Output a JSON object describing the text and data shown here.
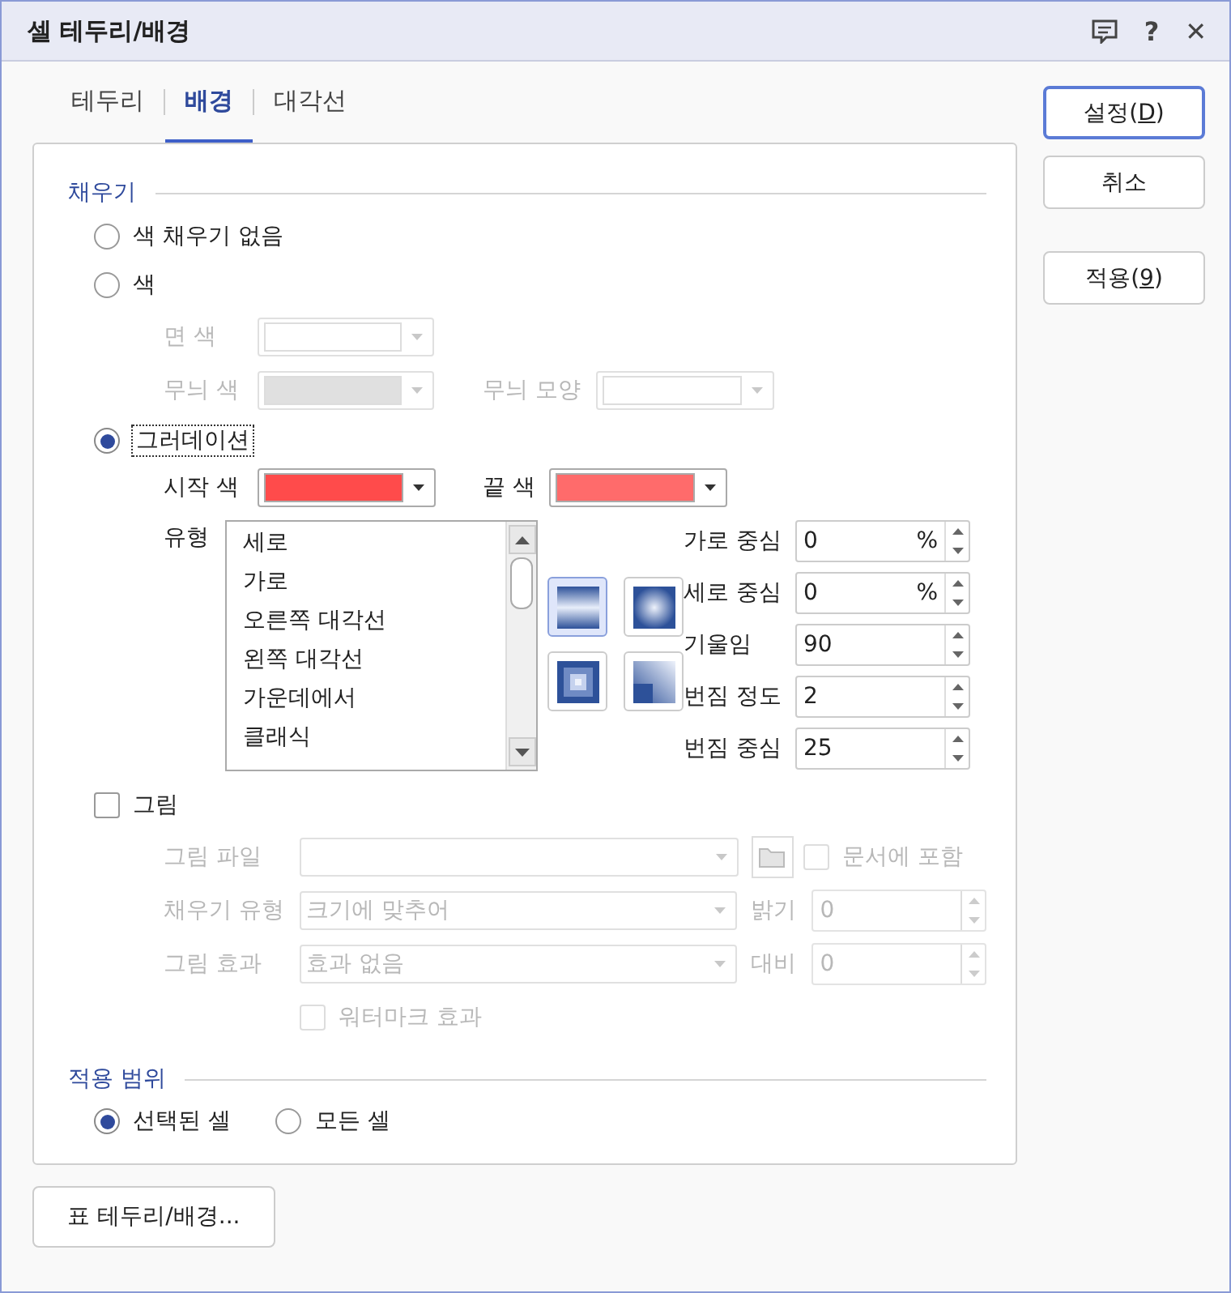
{
  "window": {
    "title": "셀 테두리/배경",
    "help_button": "?",
    "close_button": "✕"
  },
  "tabs": [
    {
      "label": "테두리",
      "selected": false
    },
    {
      "label": "배경",
      "selected": true
    },
    {
      "label": "대각선",
      "selected": false
    }
  ],
  "fill": {
    "heading": "채우기",
    "options": [
      {
        "label": "색 채우기 없음",
        "selected": false,
        "focused": false
      },
      {
        "label": "색",
        "selected": false,
        "focused": false
      },
      {
        "label": "그러데이션",
        "selected": true,
        "focused": true
      }
    ],
    "color_settings": {
      "disabled": true,
      "face_color": {
        "label": "면 색",
        "color": "#ffffff"
      },
      "pattern_color": {
        "label": "무늬 색",
        "color": "#e0e0e0"
      },
      "pattern_shape": {
        "label": "무늬 모양"
      }
    },
    "gradient": {
      "start": {
        "label": "시작 색",
        "color": "#ff4b4b"
      },
      "end": {
        "label": "끝 색",
        "color": "#ff6b6b"
      },
      "type_label": "유형",
      "types": [
        "세로",
        "가로",
        "오른쪽 대각선",
        "왼쪽 대각선",
        "가운데에서",
        "클래식"
      ],
      "styles": [
        {
          "kind": "vertical",
          "selected": true
        },
        {
          "kind": "radial",
          "selected": false
        },
        {
          "kind": "square",
          "selected": false
        },
        {
          "kind": "corner",
          "selected": false
        }
      ],
      "params": [
        {
          "label": "가로 중심",
          "value": "0",
          "unit": "%"
        },
        {
          "label": "세로 중심",
          "value": "0",
          "unit": "%"
        },
        {
          "label": "기울임",
          "value": "90"
        },
        {
          "label": "번짐 정도",
          "value": "2"
        },
        {
          "label": "번짐 중심",
          "value": "25"
        }
      ]
    }
  },
  "picture": {
    "label": "그림",
    "checked": false,
    "disabled": true,
    "file_label": "그림 파일",
    "embed": {
      "label": "문서에 포함",
      "checked": false
    },
    "fill_type": {
      "label": "채우기 유형",
      "value": "크기에 맞추어"
    },
    "brightness": {
      "label": "밝기",
      "value": "0"
    },
    "effect": {
      "label": "그림 효과",
      "value": "효과 없음"
    },
    "contrast": {
      "label": "대비",
      "value": "0"
    },
    "watermark": {
      "label": "워터마크 효과",
      "checked": false
    }
  },
  "scope": {
    "heading": "적용 범위",
    "options": [
      {
        "label": "선택된 셀",
        "selected": true
      },
      {
        "label": "모든 셀",
        "selected": false
      }
    ]
  },
  "table_button": "표 테두리/배경...",
  "buttons": [
    {
      "text": "설정(",
      "key": "D",
      "tail": ")",
      "default": true
    },
    {
      "text": "취소",
      "default": false
    },
    {
      "text": "적용(",
      "key": "9",
      "tail": ")",
      "default": false
    }
  ]
}
